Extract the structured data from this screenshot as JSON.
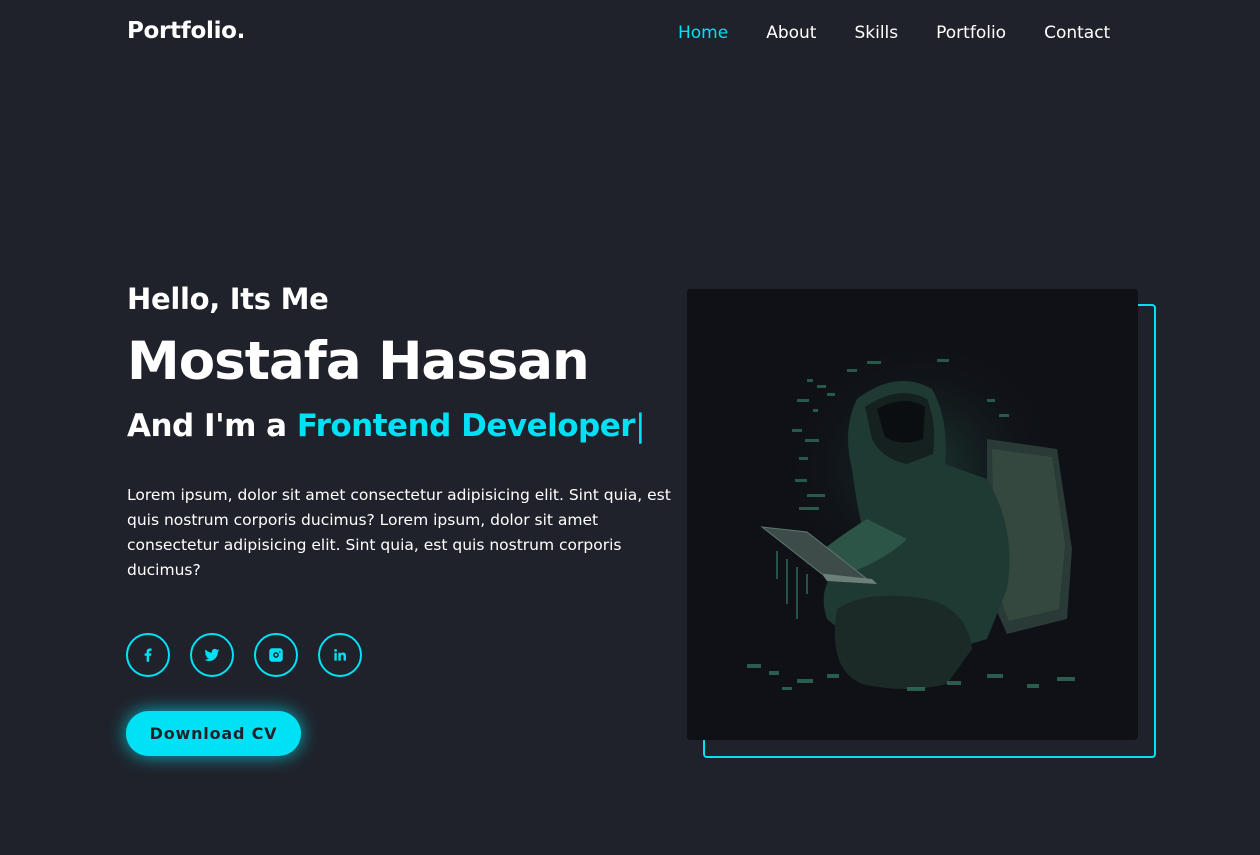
{
  "header": {
    "logo": "Portfolio.",
    "nav": [
      {
        "label": "Home",
        "active": true
      },
      {
        "label": "About",
        "active": false
      },
      {
        "label": "Skills",
        "active": false
      },
      {
        "label": "Portfolio",
        "active": false
      },
      {
        "label": "Contact",
        "active": false
      }
    ]
  },
  "hero": {
    "greeting": "Hello, Its Me",
    "name": "Mostafa Hassan",
    "role_prefix": "And I'm a",
    "role": "Frontend Developer",
    "cursor": "|",
    "description": "Lorem ipsum, dolor sit amet consectetur adipisicing elit. Sint quia, est quis nostrum corporis ducimus? Lorem ipsum, dolor sit amet consectetur adipisicing elit. Sint quia, est quis nostrum corporis ducimus?",
    "socials": [
      {
        "icon": "facebook-icon"
      },
      {
        "icon": "twitter-icon"
      },
      {
        "icon": "instagram-icon"
      },
      {
        "icon": "linkedin-icon"
      }
    ],
    "cta_label": "Download CV"
  },
  "colors": {
    "accent": "#00e1f5",
    "background": "#1f222a",
    "text": "#ffffff"
  }
}
